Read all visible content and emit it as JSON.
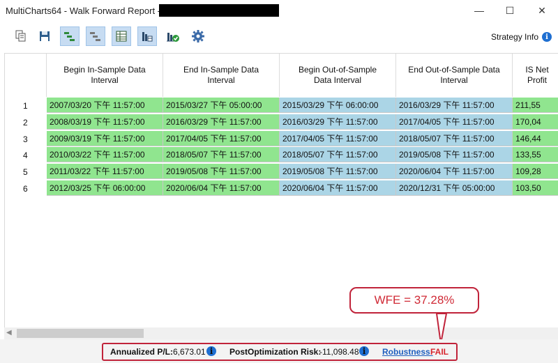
{
  "window": {
    "title": "MultiCharts64 - Walk Forward Report - ",
    "controls": {
      "minimize": "—",
      "maximize": "☐",
      "close": "✕"
    }
  },
  "toolbar": {
    "buttons": [
      {
        "name": "copy-icon",
        "active": false
      },
      {
        "name": "save-icon",
        "active": false
      },
      {
        "name": "gantt-green-icon",
        "active": true
      },
      {
        "name": "gantt-gray-icon",
        "active": true
      },
      {
        "name": "table-icon",
        "active": true
      },
      {
        "name": "calendar-chart-icon",
        "active": true
      },
      {
        "name": "chart-check-icon",
        "active": false
      },
      {
        "name": "gear-icon",
        "active": false
      }
    ],
    "strategy_info": "Strategy Info"
  },
  "table": {
    "columns": [
      {
        "label": "Begin In-Sample Data\nInterval"
      },
      {
        "label": "End In-Sample Data\nInterval"
      },
      {
        "label": "Begin Out-of-Sample\nData Interval"
      },
      {
        "label": "End Out-of-Sample Data\nInterval"
      },
      {
        "label": "IS Net\nProfit"
      }
    ],
    "rows": [
      {
        "num": "1",
        "cells": [
          "2007/03/20 下午 11:57:00",
          "2015/03/27 下午 05:00:00",
          "2015/03/29 下午 06:00:00",
          "2016/03/29 下午 11:57:00",
          "211,55"
        ]
      },
      {
        "num": "2",
        "cells": [
          "2008/03/19 下午 11:57:00",
          "2016/03/29 下午 11:57:00",
          "2016/03/29 下午 11:57:00",
          "2017/04/05 下午 11:57:00",
          "170,04"
        ]
      },
      {
        "num": "3",
        "cells": [
          "2009/03/19 下午 11:57:00",
          "2017/04/05 下午 11:57:00",
          "2017/04/05 下午 11:57:00",
          "2018/05/07 下午 11:57:00",
          "146,44"
        ]
      },
      {
        "num": "4",
        "cells": [
          "2010/03/22 下午 11:57:00",
          "2018/05/07 下午 11:57:00",
          "2018/05/07 下午 11:57:00",
          "2019/05/08 下午 11:57:00",
          "133,55"
        ]
      },
      {
        "num": "5",
        "cells": [
          "2011/03/22 下午 11:57:00",
          "2019/05/08 下午 11:57:00",
          "2019/05/08 下午 11:57:00",
          "2020/06/04 下午 11:57:00",
          "109,28"
        ]
      },
      {
        "num": "6",
        "cells": [
          "2012/03/25 下午 06:00:00",
          "2020/06/04 下午 11:57:00",
          "2020/06/04 下午 11:57:00",
          "2020/12/31 下午 05:00:00",
          "103,50"
        ]
      }
    ]
  },
  "status": {
    "annualized_label": "Annualized P/L:",
    "annualized_value": "6,673.01",
    "risk_label": "PostOptimization Risk:",
    "risk_value": "-11,098.48",
    "robustness_label": "Robustness:",
    "robustness_value": "FAIL"
  },
  "callout": {
    "text": "WFE = 37.28%"
  },
  "colors": {
    "in_sample": "#90e58f",
    "out_sample": "#abd5e6",
    "highlight": "#c0233a"
  }
}
